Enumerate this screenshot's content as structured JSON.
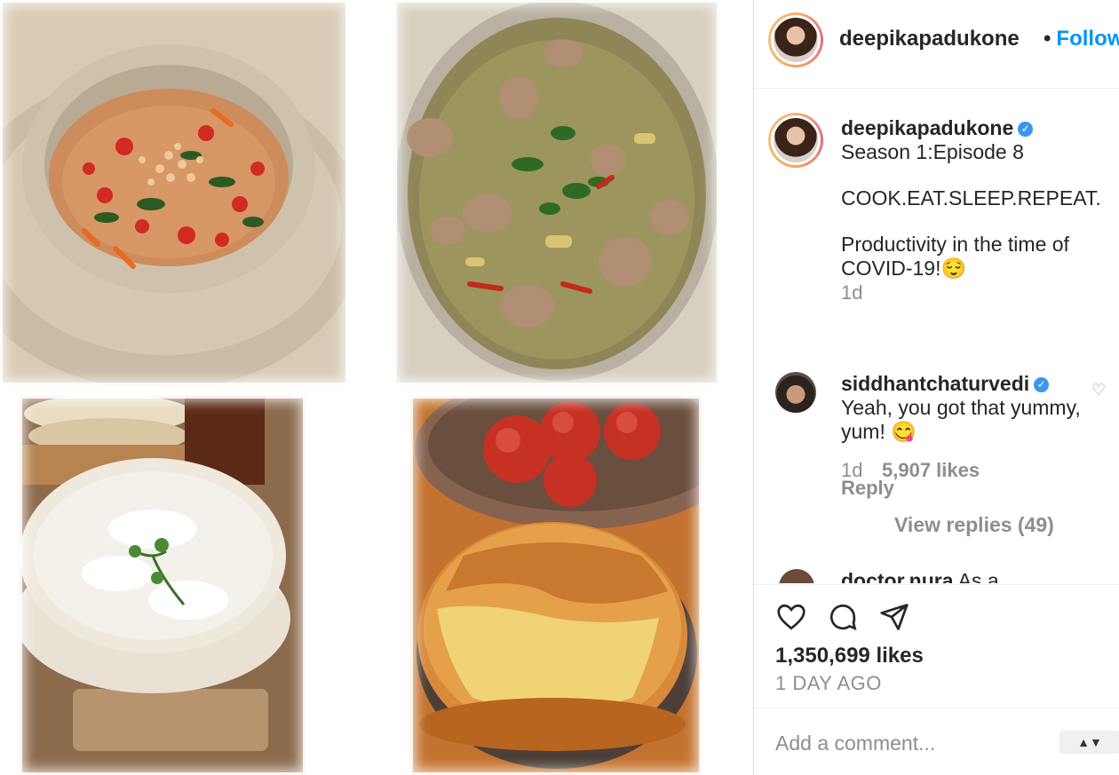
{
  "colors": {
    "follow_blue": "#0095f6",
    "verified_blue": "#3897f0",
    "muted_gray": "#8e8e8e",
    "text": "#262626"
  },
  "collage": {
    "photos": [
      {
        "name": "curry-bowl-photo"
      },
      {
        "name": "chicken-curry-pot-photo"
      },
      {
        "name": "rice-bowl-photo"
      },
      {
        "name": "sponge-cake-photo"
      }
    ]
  },
  "header": {
    "username": "deepikapadukone",
    "follow_label": "Follow",
    "dot": "•"
  },
  "caption": {
    "username": "deepikapadukone",
    "verified_icon": "verified-badge-icon",
    "line1": "Season 1:Episode 8",
    "line2": "COOK.EAT.SLEEP.REPEAT.",
    "line3": "Productivity in the time of",
    "line4": "COVID-19!😌",
    "time": "1d"
  },
  "comments": [
    {
      "username": "siddhantchaturvedi",
      "text": "Yeah, you got that yummy, yum! 😋",
      "time": "1d",
      "likes": "5,907 likes",
      "reply_label": "Reply",
      "view_replies": "View replies (49)"
    },
    {
      "username": "doctor.nura",
      "text": "As a"
    }
  ],
  "actions": {
    "like_icon": "heart-icon",
    "comment_icon": "comment-bubble-icon",
    "share_icon": "paper-plane-icon",
    "likes": "1,350,699 likes",
    "age": "1 DAY AGO"
  },
  "add_comment": {
    "placeholder": "Add a comment...",
    "arrow": "▲▼"
  }
}
